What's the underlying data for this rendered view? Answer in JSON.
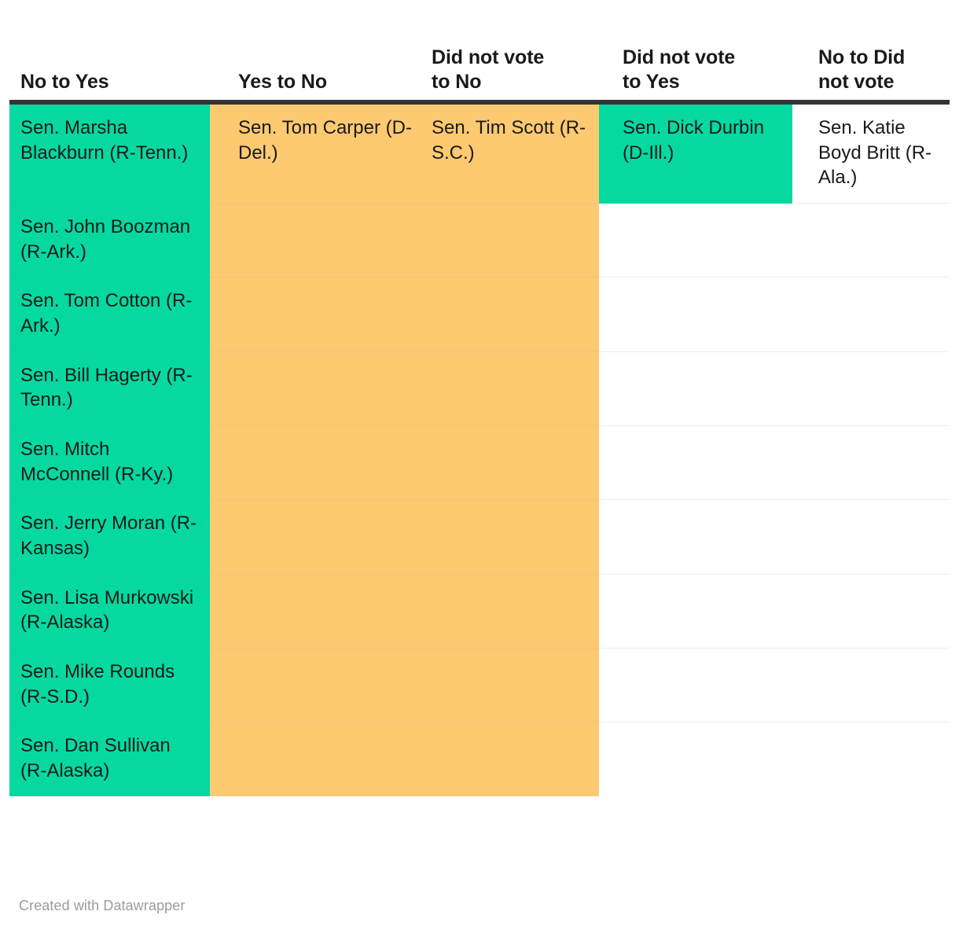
{
  "table": {
    "columns": [
      {
        "key": "no_to_yes",
        "label": "No to Yes",
        "fill": "green"
      },
      {
        "key": "yes_to_no",
        "label": "Yes to No",
        "fill": "orange"
      },
      {
        "key": "did_not_vote_to_no",
        "label": "Did not vote to No",
        "fill": "orange"
      },
      {
        "key": "did_not_vote_to_yes",
        "label": "Did not vote to Yes",
        "fill": "green"
      },
      {
        "key": "no_to_did_not_vote",
        "label": "No to Did not vote",
        "fill": "none"
      }
    ],
    "header_lines": [
      [
        "No to Yes"
      ],
      [
        "Yes to No"
      ],
      [
        "Did not vote",
        "to No"
      ],
      [
        "Did not vote",
        "to Yes"
      ],
      [
        "No to Did",
        "not vote"
      ]
    ],
    "rows": [
      {
        "no_to_yes": "Sen. Marsha Blackburn (R-Tenn.)",
        "yes_to_no": "Sen. Tom Carper (D-Del.)",
        "did_not_vote_to_no": "Sen. Tim Scott (R-S.C.)",
        "did_not_vote_to_yes": "Sen. Dick Durbin (D-Ill.)",
        "no_to_did_not_vote": "Sen. Katie Boyd Britt (R-Ala.)"
      },
      {
        "no_to_yes": "Sen. John Boozman (R-Ark.)",
        "yes_to_no": "",
        "did_not_vote_to_no": "",
        "did_not_vote_to_yes": "",
        "no_to_did_not_vote": ""
      },
      {
        "no_to_yes": "Sen. Tom Cotton (R-Ark.)",
        "yes_to_no": "",
        "did_not_vote_to_no": "",
        "did_not_vote_to_yes": "",
        "no_to_did_not_vote": ""
      },
      {
        "no_to_yes": "Sen. Bill Hagerty (R-Tenn.)",
        "yes_to_no": "",
        "did_not_vote_to_no": "",
        "did_not_vote_to_yes": "",
        "no_to_did_not_vote": ""
      },
      {
        "no_to_yes": "Sen. Mitch McConnell (R-Ky.)",
        "yes_to_no": "",
        "did_not_vote_to_no": "",
        "did_not_vote_to_yes": "",
        "no_to_did_not_vote": ""
      },
      {
        "no_to_yes": "Sen. Jerry Moran (R-Kansas)",
        "yes_to_no": "",
        "did_not_vote_to_no": "",
        "did_not_vote_to_yes": "",
        "no_to_did_not_vote": ""
      },
      {
        "no_to_yes": "Sen. Lisa Murkowski (R-Alaska)",
        "yes_to_no": "",
        "did_not_vote_to_no": "",
        "did_not_vote_to_yes": "",
        "no_to_did_not_vote": ""
      },
      {
        "no_to_yes": "Sen. Mike Rounds (R-S.D.)",
        "yes_to_no": "",
        "did_not_vote_to_no": "",
        "did_not_vote_to_yes": "",
        "no_to_did_not_vote": ""
      },
      {
        "no_to_yes": "Sen. Dan Sullivan (R-Alaska)",
        "yes_to_no": "",
        "did_not_vote_to_no": "",
        "did_not_vote_to_yes": "",
        "no_to_did_not_vote": ""
      }
    ]
  },
  "footer": {
    "credit": "Created with Datawrapper"
  },
  "colors": {
    "green": "#05d9a0",
    "orange": "#fdc971",
    "header_rule": "#333438",
    "text": "#1a1a1a",
    "footer_text": "#9c9c9c",
    "row_divider": "#eceef0",
    "background": "#ffffff"
  },
  "chart_data": {
    "type": "table",
    "title": "",
    "columns": [
      "No to Yes",
      "Yes to No",
      "Did not vote to No",
      "Did not vote to Yes",
      "No to Did not vote"
    ],
    "column_fill_colors": [
      "#05d9a0",
      "#fdc971",
      "#fdc971",
      "#05d9a0",
      "#ffffff"
    ],
    "counts": [
      9,
      1,
      1,
      1,
      1
    ],
    "rows": [
      [
        "Sen. Marsha Blackburn (R-Tenn.)",
        "Sen. Tom Carper (D-Del.)",
        "Sen. Tim Scott (R-S.C.)",
        "Sen. Dick Durbin (D-Ill.)",
        "Sen. Katie Boyd Britt (R-Ala.)"
      ],
      [
        "Sen. John Boozman (R-Ark.)",
        "",
        "",
        "",
        ""
      ],
      [
        "Sen. Tom Cotton (R-Ark.)",
        "",
        "",
        "",
        ""
      ],
      [
        "Sen. Bill Hagerty (R-Tenn.)",
        "",
        "",
        "",
        ""
      ],
      [
        "Sen. Mitch McConnell (R-Ky.)",
        "",
        "",
        "",
        ""
      ],
      [
        "Sen. Jerry Moran (R-Kansas)",
        "",
        "",
        "",
        ""
      ],
      [
        "Sen. Lisa Murkowski (R-Alaska)",
        "",
        "",
        "",
        ""
      ],
      [
        "Sen. Mike Rounds (R-S.D.)",
        "",
        "",
        "",
        ""
      ],
      [
        "Sen. Dan Sullivan (R-Alaska)",
        "",
        "",
        "",
        ""
      ]
    ],
    "legend": [],
    "annotations": [
      "Created with Datawrapper"
    ]
  }
}
